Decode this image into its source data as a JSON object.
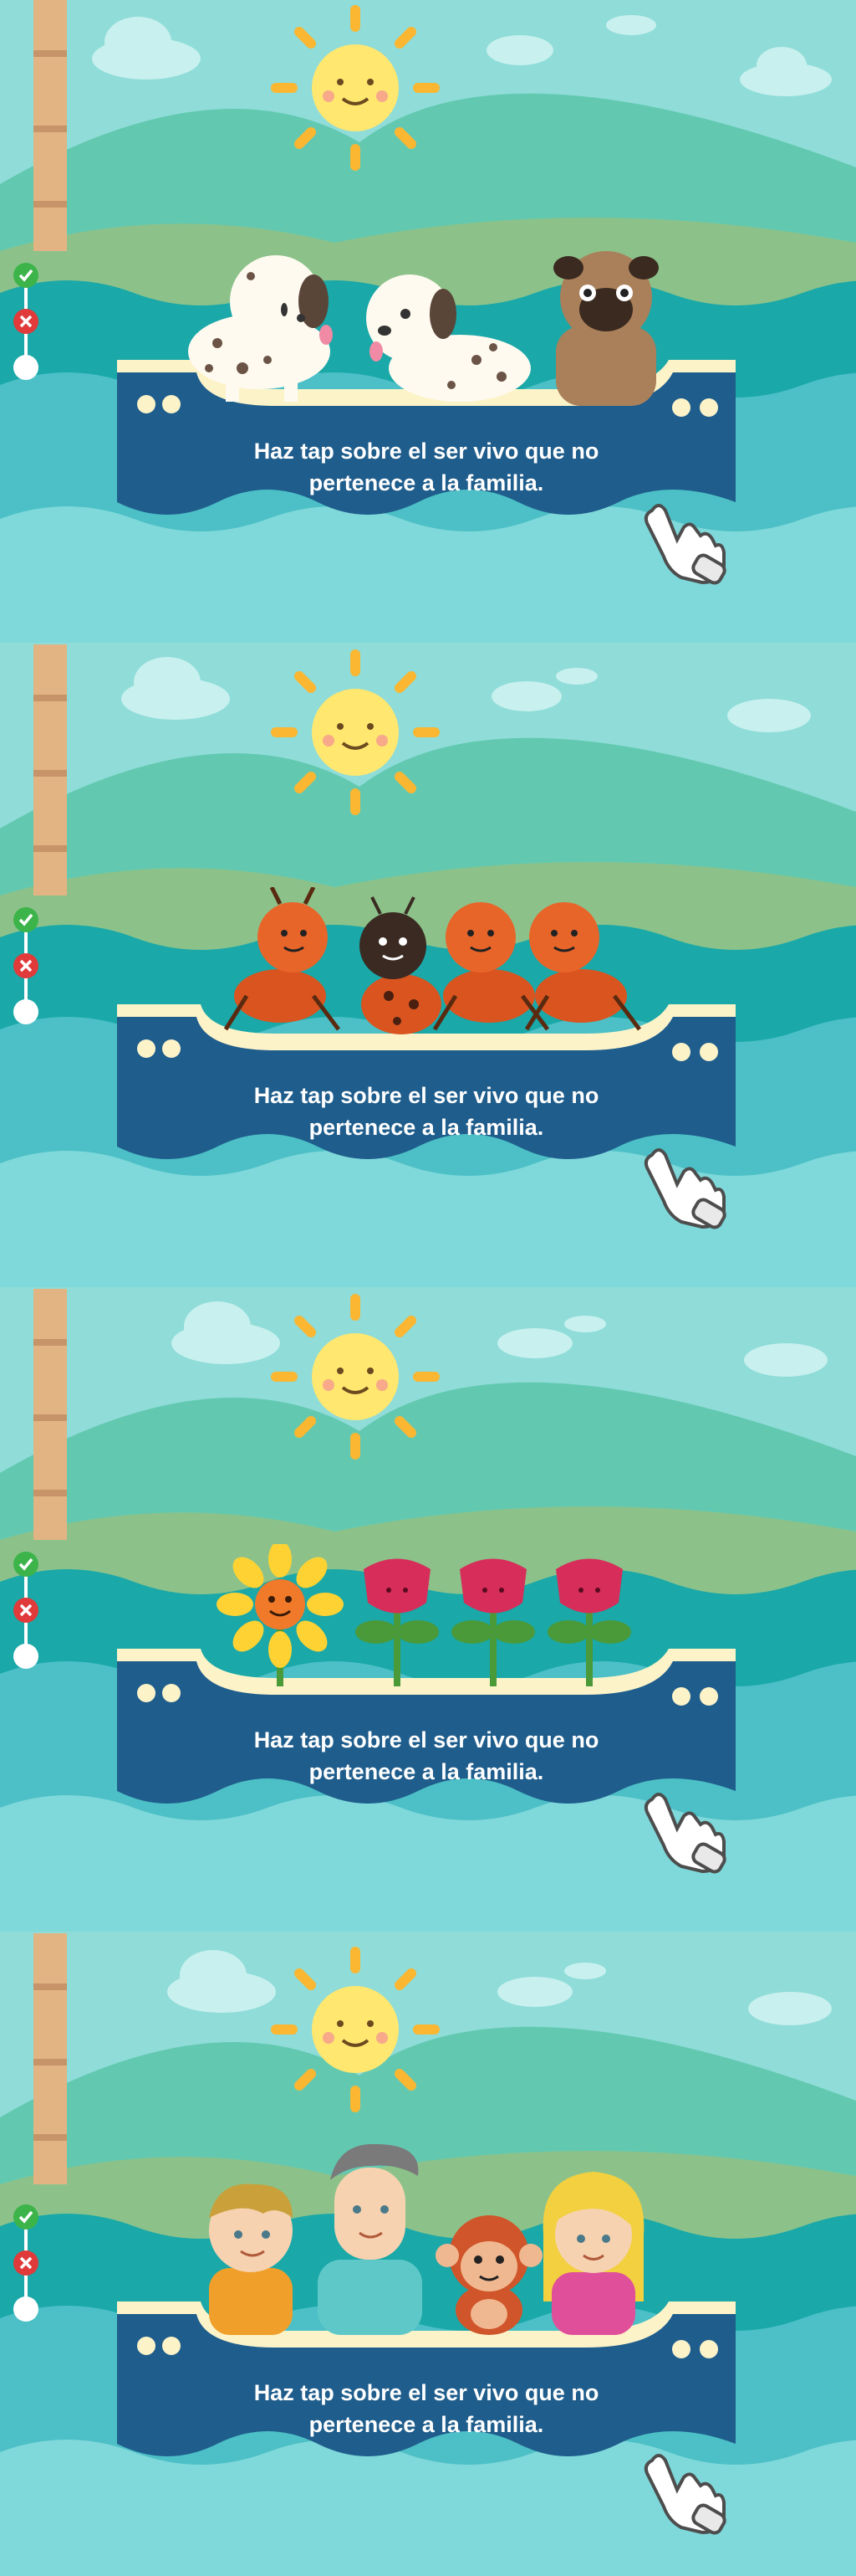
{
  "screens": [
    {
      "instruction": "Haz tap sobre el ser vivo que no pertenece a la familia.",
      "group": "dogs",
      "items": [
        "dalmatian-dog",
        "dalmatian-dog",
        "pug-dog"
      ]
    },
    {
      "instruction": "Haz tap sobre el ser vivo que no pertenece a la familia.",
      "group": "insects",
      "items": [
        "ant",
        "ladybug",
        "ant",
        "ant"
      ]
    },
    {
      "instruction": "Haz tap sobre el ser vivo que no pertenece a la familia.",
      "group": "flowers",
      "items": [
        "sunflower",
        "rose",
        "rose",
        "rose"
      ]
    },
    {
      "instruction": "Haz tap sobre el ser vivo que no pertenece a la familia.",
      "group": "family",
      "items": [
        "boy",
        "father",
        "monkey",
        "girl"
      ]
    }
  ],
  "progress": {
    "states": [
      "correct",
      "wrong",
      "pending"
    ]
  },
  "colors": {
    "sky": "#8fdcd8",
    "hill": "#62c9b0",
    "sea": "#1aa8a8",
    "boat": "#1f5d8c",
    "boat_trim": "#fdf3c9",
    "sun": "#ffe770"
  }
}
